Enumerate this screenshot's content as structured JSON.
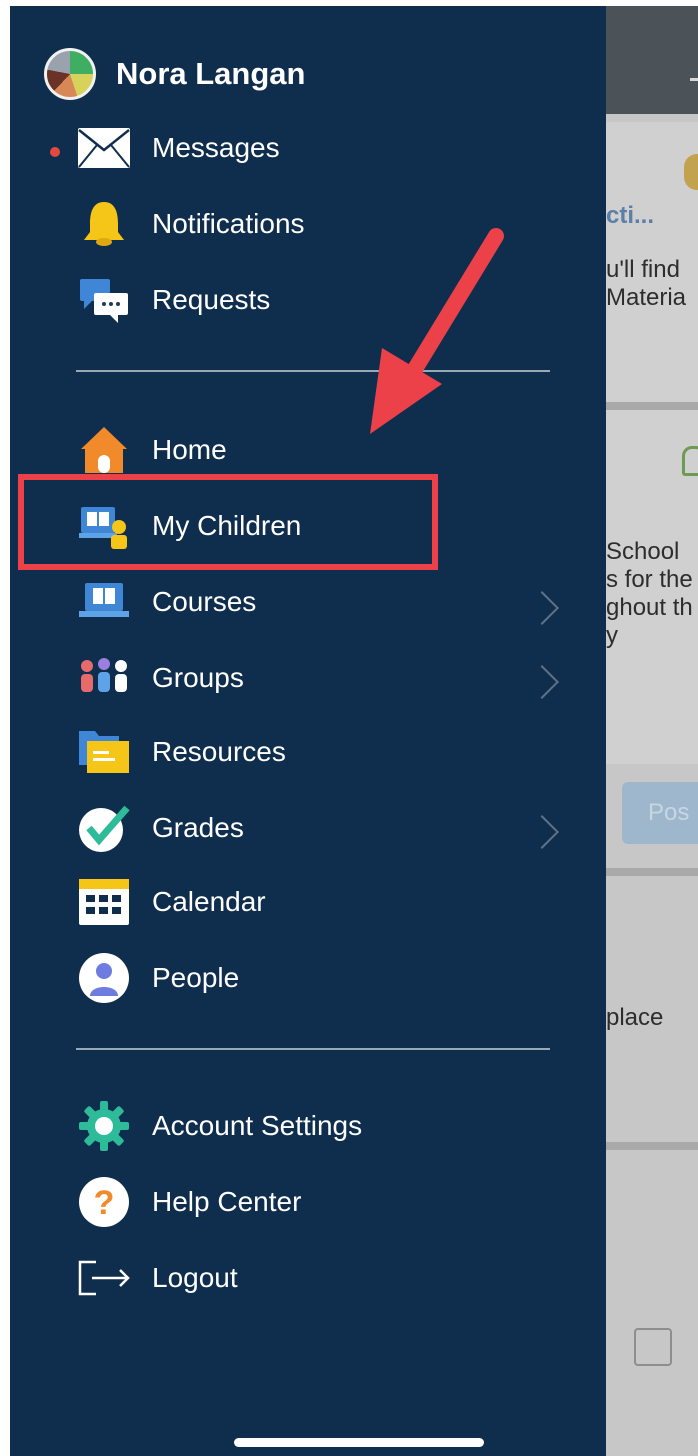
{
  "profile": {
    "name": "Nora Langan",
    "avatar_icon": "user-avatar-icon"
  },
  "menu": {
    "messages": {
      "label": "Messages",
      "icon": "envelope-icon",
      "unread": true
    },
    "notifications": {
      "label": "Notifications",
      "icon": "bell-icon"
    },
    "requests": {
      "label": "Requests",
      "icon": "chat-bubbles-icon"
    },
    "home": {
      "label": "Home",
      "icon": "house-icon"
    },
    "my_children": {
      "label": "My Children",
      "icon": "children-icon",
      "highlighted": true
    },
    "courses": {
      "label": "Courses",
      "icon": "laptop-book-icon",
      "has_submenu": true
    },
    "groups": {
      "label": "Groups",
      "icon": "group-icon",
      "has_submenu": true
    },
    "resources": {
      "label": "Resources",
      "icon": "folder-icon"
    },
    "grades": {
      "label": "Grades",
      "icon": "checkmark-icon",
      "has_submenu": true
    },
    "calendar": {
      "label": "Calendar",
      "icon": "calendar-icon"
    },
    "people": {
      "label": "People",
      "icon": "person-icon"
    },
    "account_settings": {
      "label": "Account Settings",
      "icon": "gear-icon"
    },
    "help_center": {
      "label": "Help Center",
      "icon": "question-icon"
    },
    "logout": {
      "label": "Logout",
      "icon": "logout-icon"
    }
  },
  "background": {
    "link_text": "cti...",
    "card1_line1": "u'll find",
    "card1_line2": "Materia",
    "card2_line1": "School",
    "card2_line2": "s for the",
    "card2_line3": "ghout th",
    "card2_line4": "y",
    "post_button": "Pos",
    "card3_text": "place"
  },
  "colors": {
    "drawer_bg": "#0f2e4d",
    "highlight": "#ec4149",
    "unread_dot": "#e34a3d"
  }
}
